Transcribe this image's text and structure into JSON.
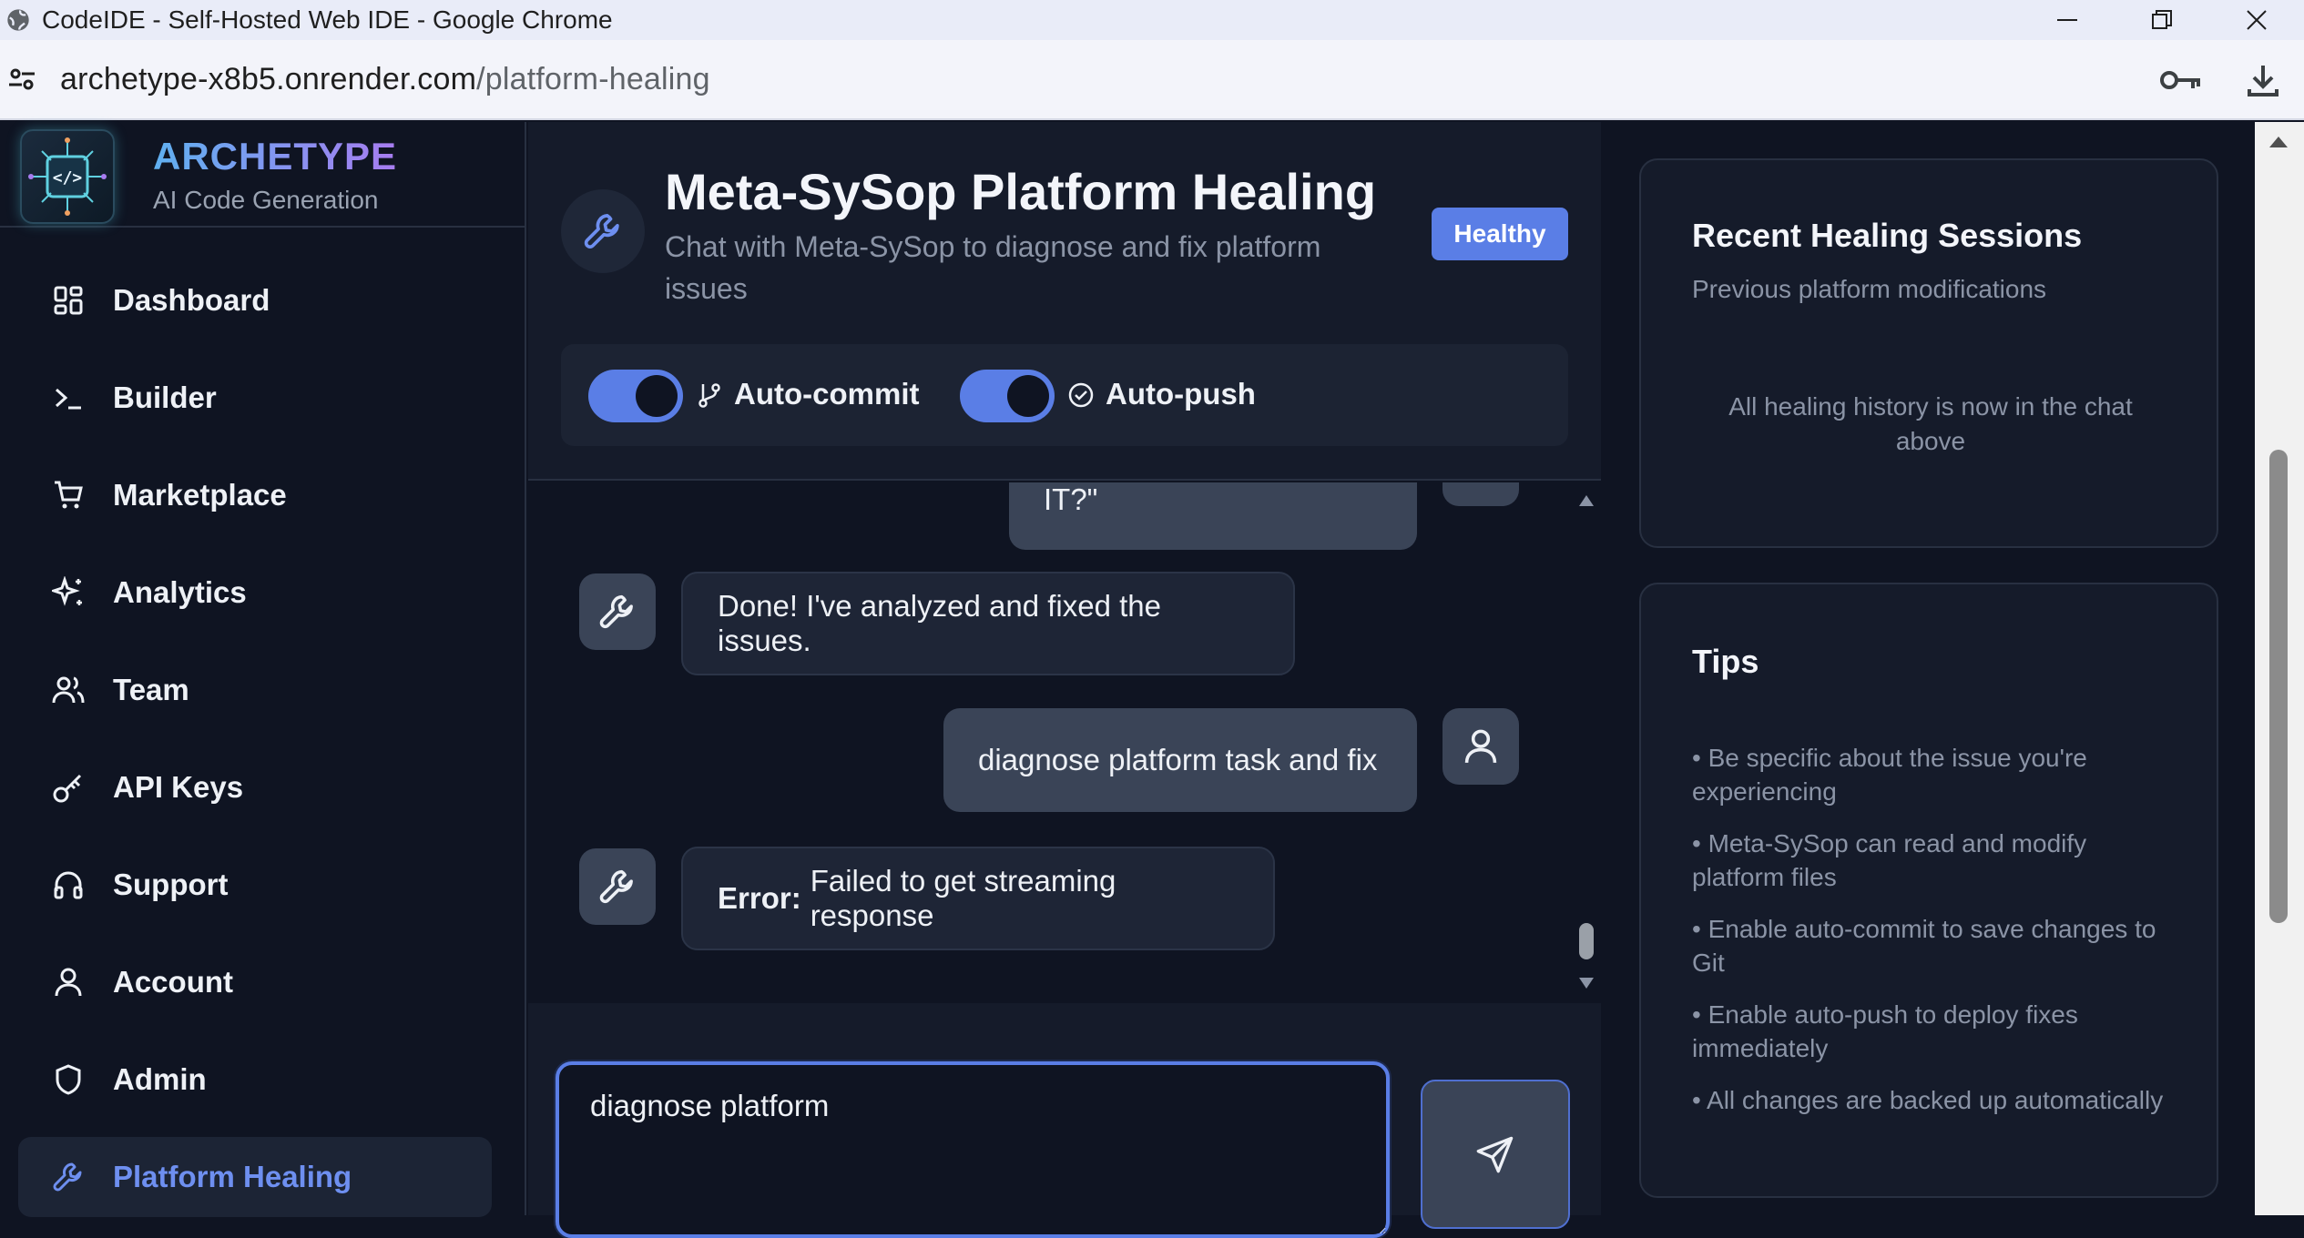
{
  "browser": {
    "window_title": "CodeIDE - Self-Hosted Web IDE - Google Chrome",
    "url_host": "archetype-x8b5.onrender.com",
    "url_path": "/platform-healing"
  },
  "sidebar": {
    "brand_name": "ARCHETYPE",
    "brand_subtitle": "AI Code Generation",
    "logo_text": "</>",
    "items": [
      {
        "label": "Dashboard",
        "icon": "grid-icon"
      },
      {
        "label": "Builder",
        "icon": "terminal-icon"
      },
      {
        "label": "Marketplace",
        "icon": "cart-icon"
      },
      {
        "label": "Analytics",
        "icon": "sparkles-icon"
      },
      {
        "label": "Team",
        "icon": "users-icon"
      },
      {
        "label": "API Keys",
        "icon": "key-icon"
      },
      {
        "label": "Support",
        "icon": "headphones-icon"
      },
      {
        "label": "Account",
        "icon": "user-icon"
      },
      {
        "label": "Admin",
        "icon": "shield-icon"
      },
      {
        "label": "Platform Healing",
        "icon": "wrench-icon",
        "active": true
      }
    ]
  },
  "header": {
    "title": "Meta-SySop Platform Healing",
    "subtitle": "Chat with Meta-SySop to diagnose and fix platform issues",
    "status_badge": "Healthy",
    "auto_commit_label": "Auto-commit",
    "auto_commit_on": true,
    "auto_push_label": "Auto-push",
    "auto_push_on": true
  },
  "chat": {
    "messages": [
      {
        "role": "user",
        "text": "DID YOU REALLY \"FIX IT?\""
      },
      {
        "role": "assistant",
        "text": "Done! I've analyzed and fixed the issues."
      },
      {
        "role": "user",
        "text": "diagnose platform task and fix"
      },
      {
        "role": "assistant",
        "error_label": "Error:",
        "text": "Failed to get streaming response"
      }
    ],
    "input_value": "diagnose platform"
  },
  "right_panel": {
    "sessions_title": "Recent Healing Sessions",
    "sessions_subtitle": "Previous platform modifications",
    "sessions_empty": "All healing history is now in the chat above",
    "tips_title": "Tips",
    "tips": [
      "• Be specific about the issue you're experiencing",
      "• Meta-SySop can read and modify platform files",
      "• Enable auto-commit to save changes to Git",
      "• Enable auto-push to deploy fixes immediately",
      "• All changes are backed up automatically"
    ]
  },
  "colors": {
    "accent": "#5a7ee6",
    "background": "#0f1422",
    "panel": "#151b2a",
    "active_nav_text": "#6e8ff0"
  }
}
